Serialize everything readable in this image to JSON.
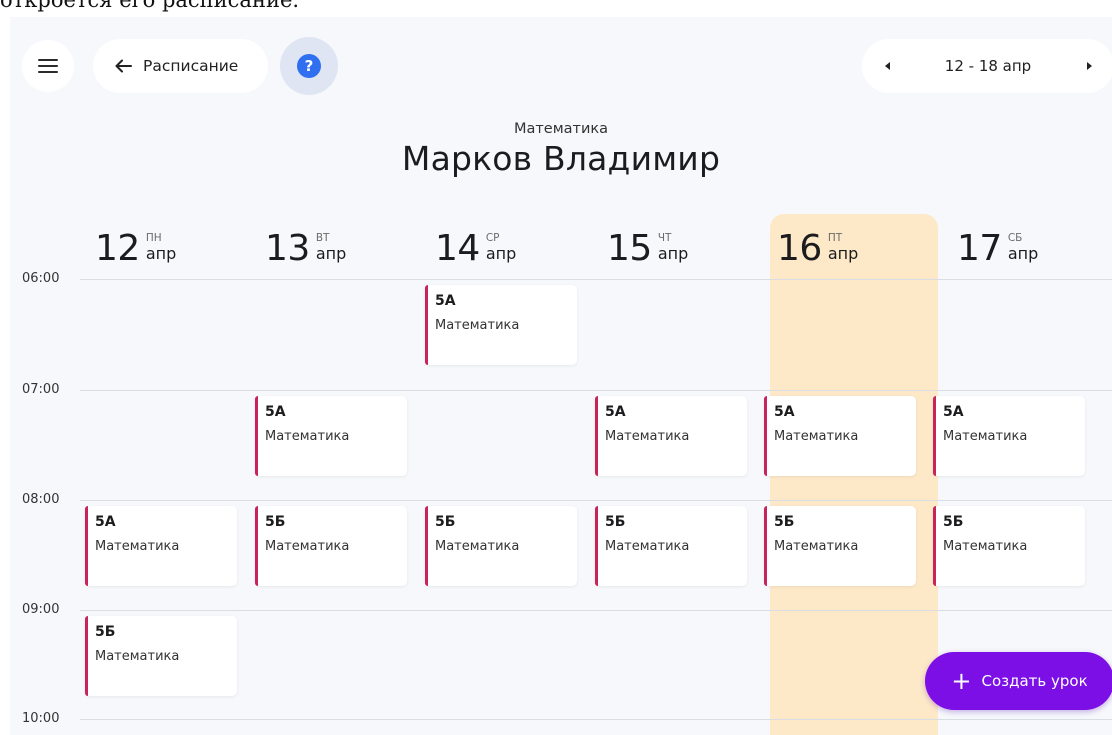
{
  "caption": "откроется его расписание.",
  "toolbar": {
    "back_label": "Расписание",
    "help_label": "?",
    "week_range": "12 - 18 апр"
  },
  "header": {
    "subject": "Математика",
    "teacher": "Марков Владимир"
  },
  "days": [
    {
      "num": "12",
      "dow": "ПН",
      "month": "апр",
      "today": false
    },
    {
      "num": "13",
      "dow": "ВТ",
      "month": "апр",
      "today": false
    },
    {
      "num": "14",
      "dow": "СР",
      "month": "апр",
      "today": false
    },
    {
      "num": "15",
      "dow": "ЧТ",
      "month": "апр",
      "today": false
    },
    {
      "num": "16",
      "dow": "ПТ",
      "month": "апр",
      "today": true
    },
    {
      "num": "17",
      "dow": "СБ",
      "month": "апр",
      "today": false
    }
  ],
  "times": [
    "06:00",
    "07:00",
    "08:00",
    "09:00",
    "10:00"
  ],
  "lessons": [
    {
      "day": 2,
      "time": "06:00",
      "class": "5А",
      "subject": "Математика"
    },
    {
      "day": 1,
      "time": "07:00",
      "class": "5А",
      "subject": "Математика"
    },
    {
      "day": 3,
      "time": "07:00",
      "class": "5А",
      "subject": "Математика"
    },
    {
      "day": 4,
      "time": "07:00",
      "class": "5А",
      "subject": "Математика"
    },
    {
      "day": 5,
      "time": "07:00",
      "class": "5А",
      "subject": "Математика"
    },
    {
      "day": 0,
      "time": "08:00",
      "class": "5А",
      "subject": "Математика"
    },
    {
      "day": 1,
      "time": "08:00",
      "class": "5Б",
      "subject": "Математика"
    },
    {
      "day": 2,
      "time": "08:00",
      "class": "5Б",
      "subject": "Математика"
    },
    {
      "day": 3,
      "time": "08:00",
      "class": "5Б",
      "subject": "Математика"
    },
    {
      "day": 4,
      "time": "08:00",
      "class": "5Б",
      "subject": "Математика"
    },
    {
      "day": 5,
      "time": "08:00",
      "class": "5Б",
      "subject": "Математика"
    },
    {
      "day": 0,
      "time": "09:00",
      "class": "5Б",
      "subject": "Математика"
    }
  ],
  "create_button": {
    "label": "Создать урок"
  },
  "colors": {
    "accent": "#7b0fe6",
    "lesson_bar": "#c8235a",
    "today_highlight": "#fde9c8",
    "help": "#2f6ff0"
  },
  "icons": {
    "menu": "hamburger-icon",
    "back": "arrow-left-icon",
    "help": "question-icon",
    "prev": "chevron-left-icon",
    "next": "chevron-right-icon",
    "plus": "plus-icon"
  }
}
